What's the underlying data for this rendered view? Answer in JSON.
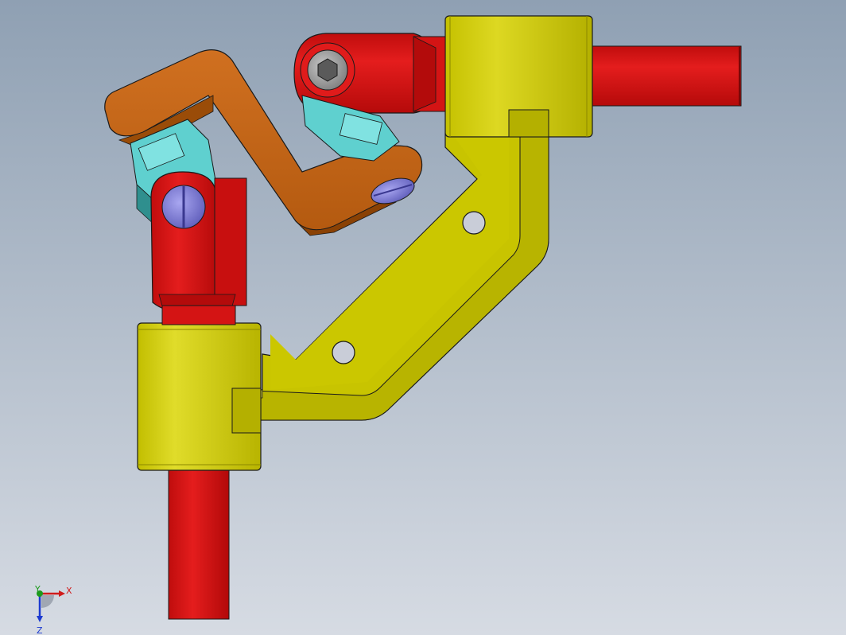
{
  "viewport": {
    "background_top": "#8fa0b3",
    "background_bottom": "#d6dbe3"
  },
  "colors": {
    "shaft_red": "#d41414",
    "shaft_red_dark": "#8e0b0b",
    "yoke_red": "#cf1010",
    "bracket_yellow": "#c8c400",
    "bracket_yellow_light": "#dfda26",
    "bracket_yellow_dark": "#8b8800",
    "link_orange": "#c8640f",
    "link_orange_dark": "#8a4104",
    "cross_cyan": "#5fd0cf",
    "cross_cyan_dark": "#2f8f8e",
    "screw_blue": "#7b79d8",
    "hex_screw_gray": "#9a9a9a",
    "edge": "#1a1a1a"
  },
  "triad": {
    "x_label": "X",
    "y_label": "Y",
    "z_label": "Z",
    "x_color": "#d01c1c",
    "y_color": "#1c9a1c",
    "z_color": "#1c3ad0"
  }
}
